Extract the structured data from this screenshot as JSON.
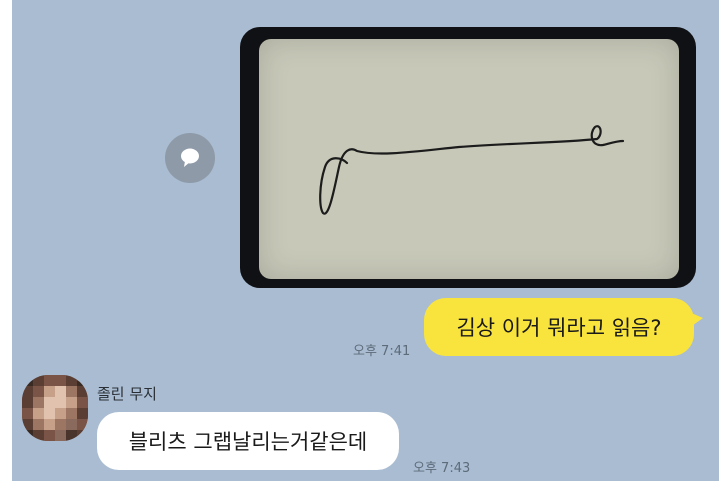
{
  "messages": {
    "photo": {
      "content": "signature photo"
    },
    "outgoing": {
      "text": "김상 이거 뭐라고 읽음?",
      "time": "오후 7:41"
    },
    "incoming": {
      "sender": "졸린 무지",
      "text": "블리츠 그랩날리는거같은데",
      "time": "오후 7:43"
    }
  },
  "colors": {
    "chat_background": "#a9bcd1",
    "my_bubble": "#f9e43d",
    "other_bubble": "#ffffff"
  },
  "icons": {
    "share": "share-bubble-icon",
    "avatar": "pixelated-avatar"
  }
}
